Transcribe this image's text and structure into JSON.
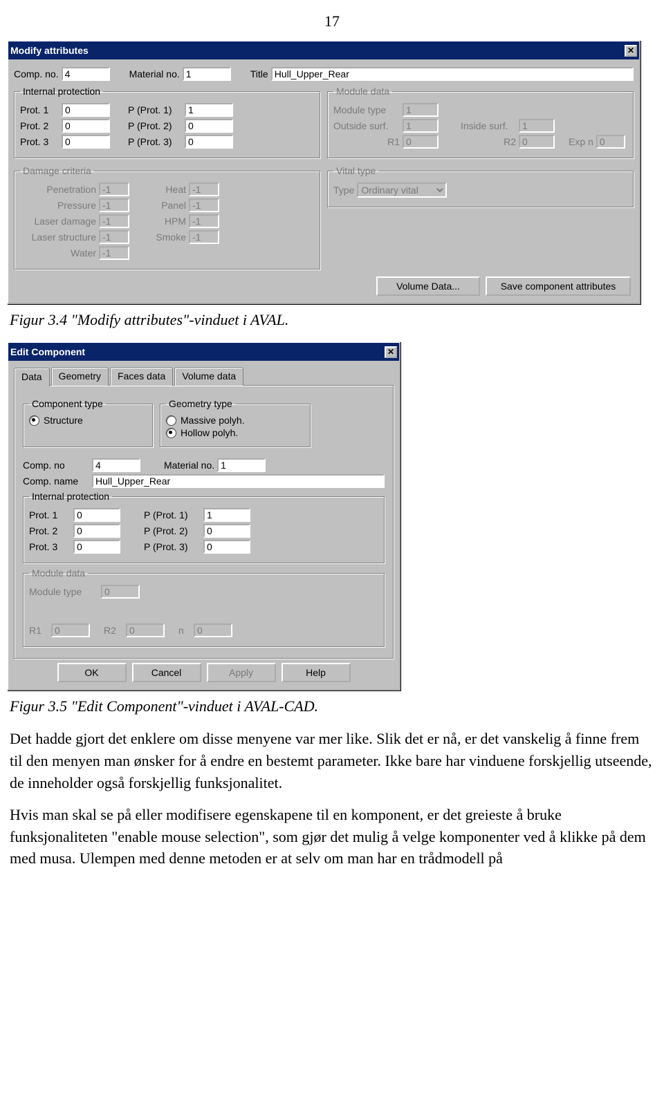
{
  "page": {
    "number": "17"
  },
  "win1": {
    "title": "Modify attributes",
    "labels": {
      "comp_no": "Comp. no.",
      "material_no": "Material no.",
      "title": "Title",
      "prot1": "Prot. 1",
      "prot2": "Prot. 2",
      "prot3": "Prot. 3",
      "pprot1": "P (Prot. 1)",
      "pprot2": "P (Prot. 2)",
      "pprot3": "P (Prot. 3)",
      "module_type": "Module type",
      "outside_surf": "Outside surf.",
      "inside_surf": "Inside surf.",
      "r1": "R1",
      "r2": "R2",
      "expn": "Exp n",
      "penetration": "Penetration",
      "heat": "Heat",
      "pressure": "Pressure",
      "panel": "Panel",
      "laser_damage": "Laser damage",
      "hpm": "HPM",
      "laser_structure": "Laser structure",
      "smoke": "Smoke",
      "water": "Water",
      "type": "Type"
    },
    "groups": {
      "internal_protection": "Internal protection",
      "module_data": "Module data",
      "damage_criteria": "Damage criteria",
      "vital_type": "Vital type"
    },
    "values": {
      "comp_no": "4",
      "material_no": "1",
      "title": "Hull_Upper_Rear",
      "prot1": "0",
      "pprot1": "1",
      "prot2": "0",
      "pprot2": "0",
      "prot3": "0",
      "pprot3": "0",
      "module_type": "1",
      "outside_surf": "1",
      "inside_surf": "1",
      "r1": "0",
      "r2": "0",
      "expn": "0",
      "penetration": "-1",
      "heat": "-1",
      "pressure": "-1",
      "panel": "-1",
      "laser_damage": "-1",
      "hpm": "-1",
      "laser_structure": "-1",
      "smoke": "-1",
      "water": "-1",
      "vital_type": "Ordinary vital"
    },
    "buttons": {
      "volume_data": "Volume Data...",
      "save_attrs": "Save component attributes"
    }
  },
  "win2": {
    "title": "Edit Component",
    "tabs": [
      "Data",
      "Geometry",
      "Faces data",
      "Volume data"
    ],
    "groups": {
      "component_type": "Component type",
      "geometry_type": "Geometry type",
      "internal_protection": "Internal protection",
      "module_data": "Module data"
    },
    "radios": {
      "structure": "Structure",
      "massive": "Massive polyh.",
      "hollow": "Hollow polyh."
    },
    "labels": {
      "comp_no": "Comp. no",
      "material_no": "Material no.",
      "comp_name": "Comp. name",
      "prot1": "Prot. 1",
      "prot2": "Prot. 2",
      "prot3": "Prot. 3",
      "pprot1": "P (Prot. 1)",
      "pprot2": "P (Prot. 2)",
      "pprot3": "P (Prot. 3)",
      "module_type": "Module type",
      "r1": "R1",
      "r2": "R2",
      "n": "n"
    },
    "values": {
      "comp_no": "4",
      "material_no": "1",
      "comp_name": "Hull_Upper_Rear",
      "prot1": "0",
      "pprot1": "1",
      "prot2": "0",
      "pprot2": "0",
      "prot3": "0",
      "pprot3": "0",
      "module_type": "0",
      "r1": "0",
      "r2": "0",
      "n": "0"
    },
    "buttons": {
      "ok": "OK",
      "cancel": "Cancel",
      "apply": "Apply",
      "help": "Help"
    }
  },
  "captions": {
    "fig1": "Figur 3.4 \"Modify attributes\"-vinduet i AVAL.",
    "fig2": "Figur 3.5 \"Edit Component\"-vinduet i AVAL-CAD."
  },
  "text": {
    "p1": "Det hadde gjort det enklere om disse menyene var mer like. Slik det er nå, er det vanskelig å finne frem til den menyen man ønsker for å endre en bestemt parameter. Ikke bare har vinduene forskjellig utseende, de inneholder også forskjellig funksjonalitet.",
    "p2": "Hvis man skal se på eller modifisere egenskapene til en komponent, er det greieste å bruke funksjonaliteten \"enable mouse selection\", som gjør det mulig å velge komponenter ved å klikke på dem med musa. Ulempen med denne metoden er at selv om man har en trådmodell på"
  }
}
